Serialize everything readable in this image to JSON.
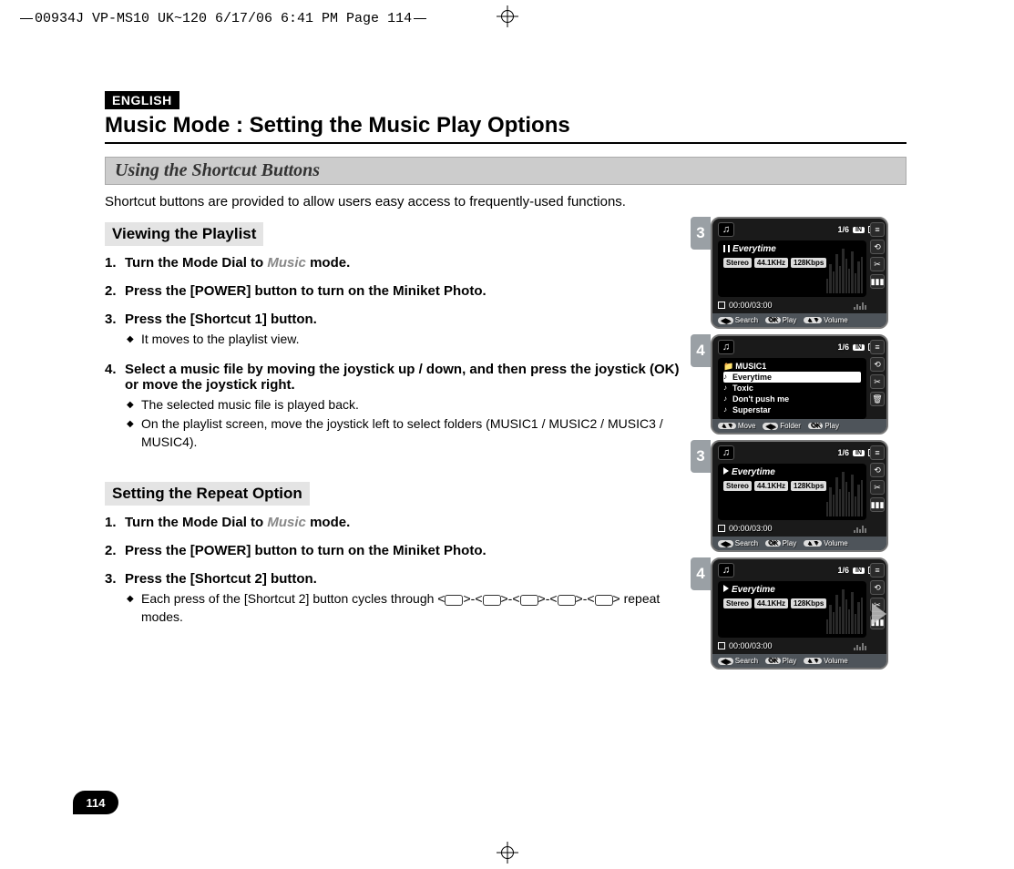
{
  "print_header": "00934J VP-MS10 UK~120  6/17/06 6:41 PM  Page 114",
  "page_number": "114",
  "lang_tag": "ENGLISH",
  "title": "Music Mode : Setting the Music Play Options",
  "section_header": "Using the Shortcut Buttons",
  "intro": "Shortcut buttons are provided to allow users easy access to frequently-used functions.",
  "sections": {
    "playlist": {
      "header": "Viewing the Playlist",
      "steps": [
        {
          "pre": "Turn the Mode Dial to ",
          "mode": "Music",
          "post": " mode."
        },
        {
          "text": "Press the [POWER] button to turn on the Miniket Photo."
        },
        {
          "text": "Press the [Shortcut 1] button.",
          "bullets": [
            "It moves to the playlist view."
          ]
        },
        {
          "text": "Select a music file by moving the joystick up / down, and then press the joystick (OK) or move the joystick right.",
          "bullets": [
            "The selected music file is played back.",
            "On the playlist screen, move the joystick left to select folders (MUSIC1 / MUSIC2 / MUSIC3 / MUSIC4)."
          ]
        }
      ]
    },
    "repeat": {
      "header": "Setting the Repeat Option",
      "steps": [
        {
          "pre": "Turn the Mode Dial to ",
          "mode": "Music",
          "post": " mode."
        },
        {
          "text": "Press the [POWER] button to turn on the Miniket Photo."
        },
        {
          "text": "Press the [Shortcut 2] button.",
          "bullets_html": [
            "Each press of the [Shortcut 2] button cycles through <__ICON__>-<__ICON__>-<__ICON__>-<__ICON__>-<__ICON__> repeat modes."
          ]
        }
      ]
    }
  },
  "screens": [
    {
      "badge": "3",
      "counter": "1/6",
      "storage": "IN",
      "track": "Everytime",
      "tags": [
        "Stereo",
        "44.1KHz",
        "128Kbps"
      ],
      "time": "00:00/03:00",
      "playing": false,
      "footer": [
        {
          "key": "◀▶",
          "label": "Search"
        },
        {
          "key": "OK",
          "label": "Play"
        },
        {
          "key": "▲▼",
          "label": "Volume"
        }
      ],
      "side": [
        "≡",
        "⟲",
        "✂",
        "▮▮▮"
      ]
    },
    {
      "badge": "4",
      "counter": "1/6",
      "storage": "IN",
      "playlist": {
        "folder": "MUSIC1",
        "items": [
          "Everytime",
          "Toxic",
          "Don't push me",
          "Superstar"
        ],
        "selected": 0
      },
      "footer": [
        {
          "key": "▲▼",
          "label": "Move"
        },
        {
          "key": "◀▶",
          "label": "Folder"
        },
        {
          "key": "OK",
          "label": "Play"
        }
      ],
      "side": [
        "≡",
        "⟲",
        "✂",
        "🗑"
      ]
    },
    {
      "badge": "3",
      "counter": "1/6",
      "storage": "IN",
      "track": "Everytime",
      "tags": [
        "Stereo",
        "44.1KHz",
        "128Kbps"
      ],
      "time": "00:00/03:00",
      "playing": true,
      "footer": [
        {
          "key": "◀▶",
          "label": "Search"
        },
        {
          "key": "OK",
          "label": "Play"
        },
        {
          "key": "▲▼",
          "label": "Volume"
        }
      ],
      "side": [
        "≡",
        "⟲",
        "✂",
        "▮▮▮"
      ]
    },
    {
      "badge": "4",
      "counter": "1/6",
      "storage": "IN",
      "track": "Everytime",
      "tags": [
        "Stereo",
        "44.1KHz",
        "128Kbps"
      ],
      "time": "00:00/03:00",
      "playing": true,
      "big_play": true,
      "footer": [
        {
          "key": "◀▶",
          "label": "Search"
        },
        {
          "key": "OK",
          "label": "Play"
        },
        {
          "key": "▲▼",
          "label": "Volume"
        }
      ],
      "side": [
        "≡",
        "⟲",
        "✂",
        "▮▮▮"
      ]
    }
  ]
}
